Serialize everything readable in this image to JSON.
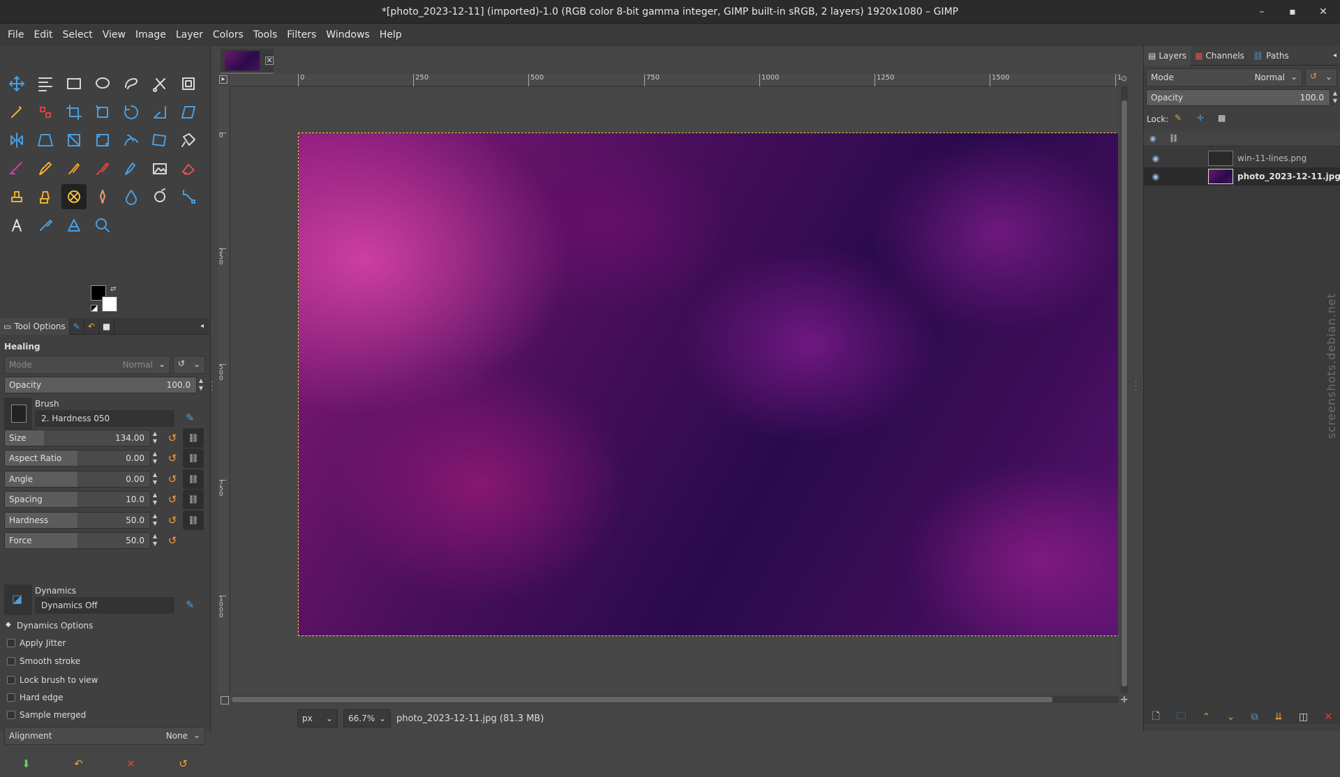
{
  "window": {
    "title": "*[photo_2023-12-11] (imported)-1.0 (RGB color 8-bit gamma integer, GIMP built-in sRGB, 2 layers) 1920x1080 – GIMP",
    "controls": [
      "–",
      "▪",
      "✕"
    ]
  },
  "menu": [
    "File",
    "Edit",
    "Select",
    "View",
    "Image",
    "Layer",
    "Colors",
    "Tools",
    "Filters",
    "Windows",
    "Help"
  ],
  "toolbox": {
    "tools": [
      {
        "name": "move-tool-icon",
        "color": "#4a9fe0"
      },
      {
        "name": "align-tool-icon",
        "color": "#d8d8d8"
      },
      {
        "name": "rect-select-icon",
        "color": "#d8d8d8"
      },
      {
        "name": "ellipse-select-icon",
        "color": "#d8d8d8"
      },
      {
        "name": "free-select-icon",
        "color": "#d8d8d8"
      },
      {
        "name": "scissors-select-icon",
        "color": "#e0e0e0"
      },
      {
        "name": "foreground-select-icon",
        "color": "#d8d8d8"
      },
      {
        "name": "fuzzy-select-icon",
        "color": "#f0b030"
      },
      {
        "name": "select-by-color-icon",
        "color": "#e04040"
      },
      {
        "name": "crop-tool-icon",
        "color": "#4a9fe0"
      },
      {
        "name": "unified-transform-icon",
        "color": "#4a9fe0"
      },
      {
        "name": "rotate-tool-icon",
        "color": "#4a9fe0"
      },
      {
        "name": "scale-tool-icon",
        "color": "#4a9fe0"
      },
      {
        "name": "shear-tool-icon",
        "color": "#4a9fe0"
      },
      {
        "name": "flip-tool-icon",
        "color": "#4a9fe0"
      },
      {
        "name": "perspective-tool-icon",
        "color": "#4a9fe0"
      },
      {
        "name": "3d-transform-icon",
        "color": "#4a9fe0"
      },
      {
        "name": "handle-transform-icon",
        "color": "#4a9fe0"
      },
      {
        "name": "warp-transform-icon",
        "color": "#4a9fe0"
      },
      {
        "name": "cage-transform-icon",
        "color": "#4a9fe0"
      },
      {
        "name": "bucket-fill-icon",
        "color": "#d8d8d8"
      },
      {
        "name": "blend-tool-icon",
        "color": "#d040a0"
      },
      {
        "name": "paintbrush-icon",
        "color": "#f0b030"
      },
      {
        "name": "pencil-icon",
        "color": "#f0a030"
      },
      {
        "name": "airbrush-icon",
        "color": "#e04040"
      },
      {
        "name": "ink-tool-icon",
        "color": "#4a9fe0"
      },
      {
        "name": "mypaint-brush-icon",
        "color": "#d8d8d8"
      },
      {
        "name": "eraser-icon",
        "color": "#e05050"
      },
      {
        "name": "clone-tool-icon",
        "color": "#f0b030"
      },
      {
        "name": "perspective-clone-icon",
        "color": "#f0b030"
      },
      {
        "name": "healing-tool-icon",
        "color": "#f0c040"
      },
      {
        "name": "smudge-tool-icon",
        "color": "#e8a070"
      },
      {
        "name": "blur-sharpen-icon",
        "color": "#4a9fe0"
      },
      {
        "name": "dodge-burn-icon",
        "color": "#d8d8d8"
      },
      {
        "name": "paths-tool-icon",
        "color": "#4a9fe0"
      },
      {
        "name": "text-tool-icon",
        "color": "#e0e0e0"
      },
      {
        "name": "color-picker-icon",
        "color": "#4a9fe0"
      },
      {
        "name": "measure-tool-icon",
        "color": "#4a9fe0"
      },
      {
        "name": "zoom-tool-icon",
        "color": "#4a9fe0"
      }
    ],
    "active_tool_index": 30,
    "fg_color": "#000000",
    "bg_color": "#ffffff"
  },
  "tool_options": {
    "tabs": [
      "Tool Options"
    ],
    "title": "Healing",
    "mode": {
      "label": "Mode",
      "value": "Normal"
    },
    "opacity": {
      "label": "Opacity",
      "value": "100.0"
    },
    "brush": {
      "label": "Brush",
      "value": "2. Hardness 050"
    },
    "sliders": [
      {
        "label": "Size",
        "value": "134.00",
        "fraction": 0.268
      },
      {
        "label": "Aspect Ratio",
        "value": "0.00",
        "fraction": 0.5
      },
      {
        "label": "Angle",
        "value": "0.00",
        "fraction": 0.5
      },
      {
        "label": "Spacing",
        "value": "10.0",
        "fraction": 0.5
      },
      {
        "label": "Hardness",
        "value": "50.0",
        "fraction": 0.5
      },
      {
        "label": "Force",
        "value": "50.0",
        "fraction": 0.5
      }
    ],
    "dynamics": {
      "label": "Dynamics",
      "value": "Dynamics Off"
    },
    "dynamics_options": "Dynamics Options",
    "checkboxes": [
      "Apply Jitter",
      "Smooth stroke",
      "Lock brush to view",
      "Hard edge",
      "Sample merged"
    ],
    "alignment": {
      "label": "Alignment",
      "value": "None"
    }
  },
  "canvas": {
    "ruler_h": [
      "0",
      "250",
      "500",
      "750",
      "1000",
      "1250",
      "1500",
      "1"
    ],
    "ruler_v": [
      "0",
      "250",
      "500",
      "750",
      "1000"
    ],
    "unit": "px",
    "zoom": "66.7%",
    "status": "photo_2023-12-11.jpg (81.3 MB)"
  },
  "layers_dock": {
    "tabs": [
      "Layers",
      "Channels",
      "Paths"
    ],
    "mode": {
      "label": "Mode",
      "value": "Normal"
    },
    "opacity": {
      "label": "Opacity",
      "value": "100.0"
    },
    "lock_label": "Lock:",
    "layers": [
      {
        "name": "win-11-lines.png",
        "selected": false
      },
      {
        "name": "photo_2023-12-11.jpg",
        "selected": true
      }
    ]
  },
  "watermark": "screenshots.debian.net"
}
